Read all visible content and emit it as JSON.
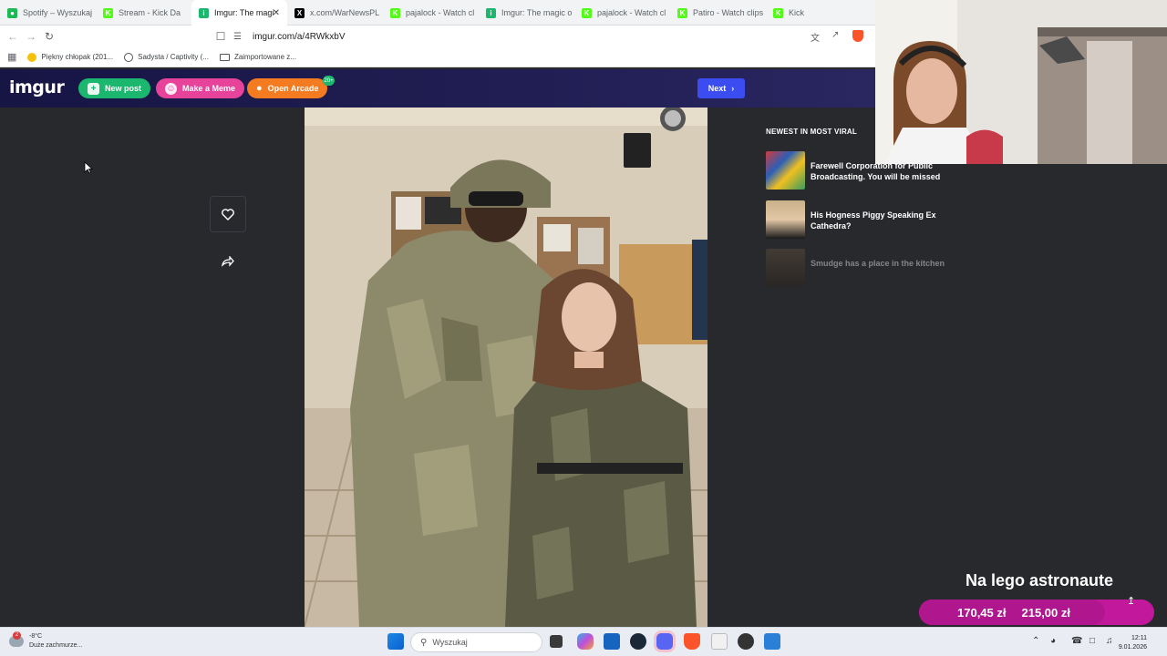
{
  "browser": {
    "tabs": [
      {
        "label": "Spotify – Wyszukaj",
        "icon": "spotify-icon",
        "color": "#1db954",
        "glyph": "●"
      },
      {
        "label": "Stream - Kick Da",
        "icon": "kick-icon",
        "color": "#53fc18",
        "glyph": "K"
      },
      {
        "label": "Imgur: The magi",
        "icon": "imgur-icon",
        "color": "#1bb76e",
        "glyph": "i",
        "active": true
      },
      {
        "label": "x.com/WarNewsPL",
        "icon": "x-icon",
        "color": "#000000",
        "glyph": "X"
      },
      {
        "label": "pajalock - Watch cl",
        "icon": "kick-icon",
        "color": "#53fc18",
        "glyph": "K"
      },
      {
        "label": "Imgur: The magic o",
        "icon": "imgur-icon",
        "color": "#1bb76e",
        "glyph": "i"
      },
      {
        "label": "pajalock - Watch cl",
        "icon": "kick-icon",
        "color": "#53fc18",
        "glyph": "K"
      },
      {
        "label": "Patiro - Watch clips",
        "icon": "kick-icon",
        "color": "#53fc18",
        "glyph": "K"
      },
      {
        "label": "Kick",
        "icon": "kick-icon",
        "color": "#53fc18",
        "glyph": "K"
      }
    ],
    "url": "imgur.com/a/4RWkxbV",
    "bookmarks": [
      {
        "label": "Piękny chłopak (201...",
        "icon": "emoji-icon"
      },
      {
        "label": "Sadysta / Captivity (...",
        "icon": "globe-icon"
      },
      {
        "label": "Zaimportowane z...",
        "icon": "folder-icon"
      }
    ]
  },
  "imgur": {
    "logo": "imgur",
    "new_post": "New post",
    "make_meme": "Make a Meme",
    "open_arcade": "Open Arcade",
    "arcade_badge": "20+",
    "next": "Next",
    "sidebar_title": "NEWEST IN MOST VIRAL",
    "viral": [
      {
        "title": "Farewell Corporation for Public Broadcasting. You will be missed"
      },
      {
        "title": "His Hogness Piggy Speaking Ex Cathedra?"
      },
      {
        "title": "Smudge has a place in the kitchen"
      }
    ]
  },
  "overlay": {
    "title": "Na lego astronaute",
    "current": "170,45 zł",
    "goal": "215,00 zł",
    "progress": 0.79
  },
  "taskbar": {
    "weather_temp": "-8°C",
    "weather_desc": "Duże zachmurze...",
    "weather_badge": "2",
    "search_placeholder": "Wyszukaj",
    "time": "12:11",
    "date": "9.01.2026"
  },
  "colors": {
    "new_post": "#1bb76e",
    "make_meme": "#e7439b",
    "open_arcade": "#f47b20",
    "next": "#3b4cf0",
    "overlay_bar": "#c2189b"
  }
}
